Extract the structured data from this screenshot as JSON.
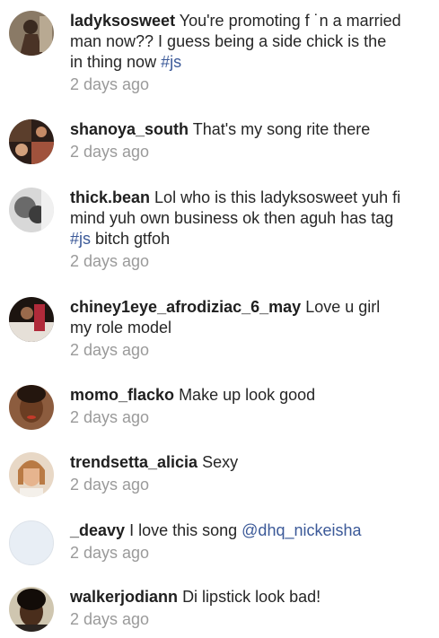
{
  "comments": [
    {
      "username": "ladyksosweet",
      "text": "You're promoting f ˙n a married man now?? I guess being a side chick is the in thing now ",
      "tags": [
        "#js"
      ],
      "time": "2 days ago"
    },
    {
      "username": "shanoya_south",
      "text": "That's my song rite there",
      "tags": [],
      "time": "2 days ago"
    },
    {
      "username": "thick.bean",
      "text": "Lol who is this ladyksosweet yuh fi mind yuh own business ok then aguh has tag ",
      "tags": [
        "#js"
      ],
      "text_after": " bitch gtfoh",
      "time": "2 days ago"
    },
    {
      "username": "chiney1eye_afrodiziac_6_may",
      "text": "Love u girl my role model",
      "tags": [],
      "time": "2 days ago"
    },
    {
      "username": "momo_flacko",
      "text": "Make up look good",
      "tags": [],
      "time": "2 days ago"
    },
    {
      "username": "trendsetta_alicia",
      "text": "Sexy",
      "tags": [],
      "time": "2 days ago"
    },
    {
      "username": "_deavy",
      "text": "I love this song ",
      "tags": [
        "@dhq_nickeisha"
      ],
      "time": "2 days ago"
    },
    {
      "username": "walkerjodiann",
      "text": "Di lipstick look bad!",
      "tags": [],
      "time": "2 days ago"
    }
  ],
  "colors": {
    "text": "#262626",
    "username": "#1f1f1f",
    "link": "#3b5998",
    "timestamp": "#9a9a9a"
  }
}
